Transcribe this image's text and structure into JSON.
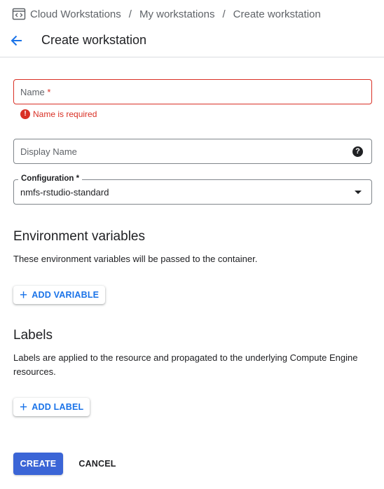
{
  "breadcrumb": {
    "icon": "workstations-code-icon",
    "items": [
      "Cloud Workstations",
      "My workstations",
      "Create workstation"
    ],
    "separator": "/"
  },
  "header": {
    "back_icon": "arrow-back-icon",
    "title": "Create workstation"
  },
  "form": {
    "name": {
      "label": "Name",
      "required_mark": "*",
      "value": "",
      "error": "Name is required",
      "error_icon": "!"
    },
    "display_name": {
      "label": "Display Name",
      "value": "",
      "help_icon": "?"
    },
    "configuration": {
      "label": "Configuration *",
      "selected": "nmfs-rstudio-standard"
    }
  },
  "env": {
    "title": "Environment variables",
    "description": "These environment variables will be passed to the container.",
    "add_label": "ADD VARIABLE",
    "add_icon": "+"
  },
  "labels": {
    "title": "Labels",
    "description": "Labels are applied to the resource and propagated to the underlying Compute Engine resources.",
    "add_label": "ADD LABEL",
    "add_icon": "+"
  },
  "actions": {
    "create": "CREATE",
    "cancel": "CANCEL"
  },
  "colors": {
    "accent": "#1a73e8",
    "primary_button": "#3b65d6",
    "error": "#d93025",
    "text": "#202124",
    "muted": "#5f6368"
  }
}
